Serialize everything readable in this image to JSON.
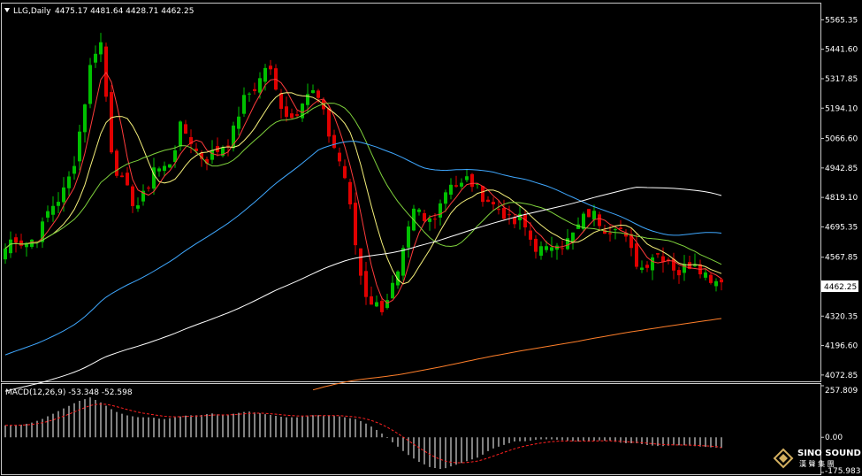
{
  "header": {
    "symbol": "LLG,Daily",
    "ohlc": "4475.17 4481.64 4428.71 4462.25"
  },
  "price_panel": {
    "y_ticks": [
      "5565.35",
      "5441.60",
      "5317.85",
      "5194.10",
      "5066.60",
      "4942.85",
      "4819.10",
      "4695.35",
      "4567.85",
      "4320.35",
      "4196.60",
      "4072.85"
    ],
    "last_price": "4462.25",
    "last_price_value": 4462.25,
    "ylim": [
      4050,
      5630
    ]
  },
  "macd_panel": {
    "label": "MACD(12,26,9) -53.348 -52.598",
    "y_ticks": [
      "257.809",
      "0.00",
      "-175.983"
    ],
    "ylim": [
      -175.983,
      257.809
    ]
  },
  "logo": {
    "name": "SINO SOUND",
    "sub": "漢 聲 集 團"
  },
  "colors": {
    "background": "#000000",
    "bull": "#00c000",
    "bear": "#e00000",
    "ma_fast": "#ff3b3b",
    "ma_mid": "#f5f07a",
    "ma_slow": "#7fd23c",
    "ma_60": "#3fa8ff",
    "ma_120": "#ffffff",
    "ma_250": "#ff7f2a",
    "macd_hist": "#ffffff",
    "macd_signal": "#ff2020"
  },
  "chart_data": {
    "type": "candlestick",
    "price_ylim": [
      4050,
      5630
    ],
    "macd_ylim": [
      -175.983,
      257.809
    ],
    "last_candle": {
      "open": 4475.17,
      "high": 4481.64,
      "low": 4428.71,
      "close": 4462.25
    },
    "macd": {
      "macd": -53.348,
      "signal": -52.598
    },
    "price_anchors": [
      4605,
      4660,
      4625,
      4640,
      4670,
      4770,
      4810,
      4860,
      4990,
      5200,
      5430,
      5470,
      5050,
      4900,
      4840,
      4780,
      4830,
      4950,
      4930,
      4980,
      5110,
      5080,
      5000,
      4980,
      5010,
      5040,
      5080,
      5210,
      5260,
      5300,
      5390,
      5260,
      5180,
      5150,
      5240,
      5270,
      5220,
      5090,
      5000,
      4890,
      4640,
      4430,
      4380,
      4350,
      4420,
      4490,
      4650,
      4780,
      4710,
      4740,
      4820,
      4890,
      4860,
      4900,
      4850,
      4820,
      4780,
      4760,
      4700,
      4730,
      4650,
      4600,
      4590,
      4650,
      4620,
      4660,
      4720,
      4760,
      4720,
      4680,
      4720,
      4640,
      4560,
      4520,
      4580,
      4580,
      4560,
      4500,
      4530,
      4560,
      4500,
      4480,
      4462
    ],
    "macd_hist_anchors": [
      60,
      60,
      70,
      90,
      120,
      150,
      180,
      200,
      170,
      130,
      110,
      100,
      100,
      90,
      100,
      110,
      110,
      120,
      110,
      120,
      130,
      120,
      110,
      100,
      100,
      110,
      110,
      110,
      100,
      90,
      60,
      20,
      -30,
      -80,
      -120,
      -150,
      -160,
      -140,
      -120,
      -100,
      -60,
      -40,
      -20,
      -20,
      -10,
      -10,
      -15,
      -20,
      -20,
      -15,
      -20,
      -30,
      -30,
      -40,
      -45,
      -40,
      -40,
      -45,
      -50,
      -53
    ]
  }
}
